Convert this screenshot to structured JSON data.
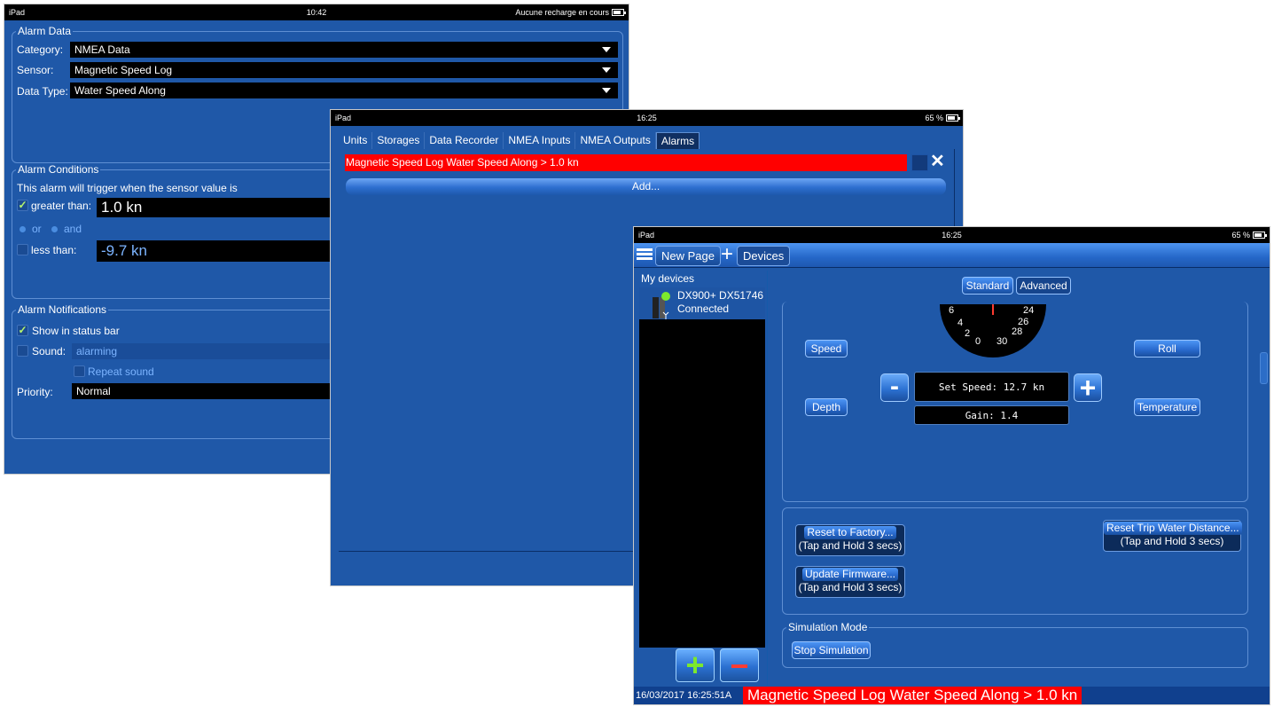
{
  "colors": {
    "panel_blue": "#1f58a8",
    "alarm_red": "#ff0000",
    "field_black": "#000000",
    "check_green": "#b7f56c",
    "plus_green": "#7ce82d",
    "minus_red": "#ff3b30"
  },
  "screen1": {
    "status": {
      "left": "iPad",
      "time": "10:42",
      "right": "Aucune recharge en cours"
    },
    "alarm_data": {
      "legend": "Alarm Data",
      "category_label": "Category:",
      "category_value": "NMEA Data",
      "sensor_label": "Sensor:",
      "sensor_value": "Magnetic Speed Log",
      "data_type_label": "Data Type:",
      "data_type_value": "Water Speed Along"
    },
    "conditions": {
      "legend": "Alarm Conditions",
      "intro": "This alarm will trigger when the sensor value is",
      "greater_label": "greater than:",
      "greater_value": "1.0 kn",
      "or_label": "or",
      "and_label": "and",
      "less_label": "less than:",
      "less_value": "-9.7 kn"
    },
    "notifications": {
      "legend": "Alarm Notifications",
      "show_status": "Show in status bar",
      "sound_label": "Sound:",
      "sound_value": "alarming",
      "repeat_sound": "Repeat sound",
      "priority_label": "Priority:",
      "priority_value": "Normal"
    }
  },
  "screen2": {
    "status": {
      "left": "iPad",
      "time": "16:25",
      "right": "65 %"
    },
    "tabs": [
      {
        "label": "Units"
      },
      {
        "label": "Storages"
      },
      {
        "label": "Data Recorder"
      },
      {
        "label": "NMEA Inputs"
      },
      {
        "label": "NMEA Outputs"
      },
      {
        "label": "Alarms"
      }
    ],
    "alarm_entry": "Magnetic Speed Log Water Speed Along > 1.0 kn",
    "close_symbol": "✕",
    "add_label": "Add..."
  },
  "screen3": {
    "status": {
      "left": "iPad",
      "time": "16:25",
      "right": "65 %"
    },
    "toolbar": {
      "new_page": "New Page",
      "plus": "+",
      "devices": "Devices"
    },
    "devices_list": {
      "title": "My devices",
      "name": "DX900+ DX51746",
      "status": "Connected"
    },
    "mode_buttons": {
      "standard": "Standard",
      "advanced": "Advanced"
    },
    "gauge": {
      "ticks": [
        "6",
        "4",
        "2",
        "0",
        "30",
        "28",
        "26",
        "24"
      ]
    },
    "controls": {
      "speed": "Speed",
      "roll": "Roll",
      "depth": "Depth",
      "temperature": "Temperature",
      "minus": "-",
      "plus": "+",
      "set_speed": "Set Speed: 12.7 kn",
      "gain": "Gain: 1.4"
    },
    "actions": {
      "reset_factory": "Reset to Factory...",
      "reset_factory_hint": "(Tap and Hold 3 secs)",
      "reset_trip": "Reset Trip Water Distance...",
      "reset_trip_hint": "(Tap and Hold 3 secs)",
      "update_firmware": "Update Firmware...",
      "update_firmware_hint": "(Tap and Hold 3 secs)"
    },
    "simulation": {
      "legend": "Simulation Mode",
      "stop": "Stop Simulation"
    },
    "device_plus": "+",
    "device_minus": "−",
    "footer": {
      "timestamp": "16/03/2017 16:25:51A",
      "alarm": "Magnetic Speed Log Water Speed Along > 1.0 kn"
    }
  }
}
